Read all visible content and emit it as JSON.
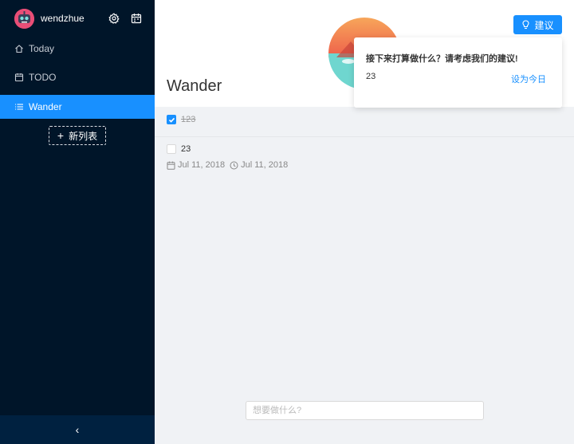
{
  "sidebar": {
    "username": "wendzhue",
    "items": [
      {
        "label": "Today"
      },
      {
        "label": "TODO"
      },
      {
        "label": "Wander"
      }
    ],
    "new_list_label": "新列表",
    "collapse_glyph": "‹"
  },
  "main": {
    "list_title": "Wander",
    "suggest_button": "建议",
    "popover": {
      "title": "接下来打算做什么？请考虑我们的建议!",
      "item": "23",
      "action": "设为今日"
    },
    "todos": [
      {
        "text": "123",
        "done": true
      },
      {
        "text": "23",
        "done": false,
        "planned_date": "Jul 11, 2018",
        "notify_date": "Jul 11, 2018"
      }
    ],
    "new_todo_placeholder": "想要做什么?"
  },
  "colors": {
    "sidebar_bg": "#001529",
    "accent": "#1890ff"
  }
}
